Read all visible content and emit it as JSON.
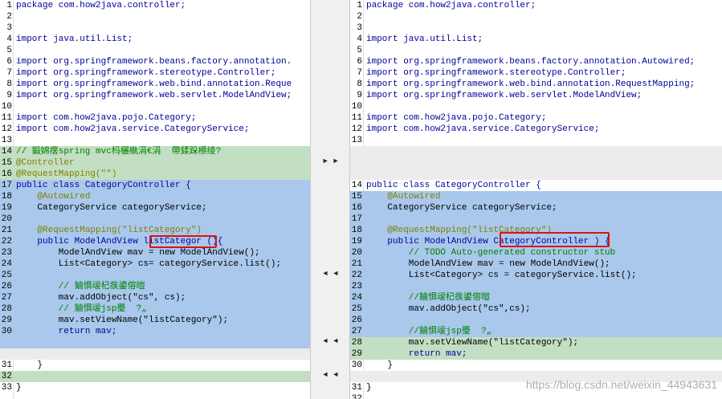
{
  "left": {
    "rows": [
      {
        "n": "1",
        "t": "package com.how2java.controller;",
        "c": ""
      },
      {
        "n": "2",
        "t": "",
        "c": ""
      },
      {
        "n": "3",
        "t": "",
        "c": ""
      },
      {
        "n": "4",
        "t": "import java.util.List;",
        "c": ""
      },
      {
        "n": "5",
        "t": "",
        "c": ""
      },
      {
        "n": "6",
        "t": "import org.springframework.beans.factory.annotation.",
        "c": ""
      },
      {
        "n": "7",
        "t": "import org.springframework.stereotype.Controller;",
        "c": ""
      },
      {
        "n": "8",
        "t": "import org.springframework.web.bind.annotation.Reque",
        "c": ""
      },
      {
        "n": "9",
        "t": "import org.springframework.web.servlet.ModelAndView;",
        "c": ""
      },
      {
        "n": "10",
        "t": "",
        "c": ""
      },
      {
        "n": "11",
        "t": "import com.how2java.pojo.Category;",
        "c": ""
      },
      {
        "n": "12",
        "t": "import com.how2java.service.CategoryService;",
        "c": ""
      },
      {
        "n": "13",
        "t": "",
        "c": ""
      },
      {
        "n": "14",
        "t": "// 鍛婂瘔spring mvc杩欐槸涓€涓  帶鍒跺櫒绫?",
        "c": "added"
      },
      {
        "n": "15",
        "t": "@Controller",
        "c": "added"
      },
      {
        "n": "16",
        "t": "@RequestMapping(\"\")",
        "c": "added"
      },
      {
        "n": "17",
        "t": "public class CategoryController {",
        "c": "changed"
      },
      {
        "n": "18",
        "t": "    @Autowired",
        "c": "changed"
      },
      {
        "n": "19",
        "t": "    CategoryService categoryService;",
        "c": "changed"
      },
      {
        "n": "20",
        "t": "",
        "c": "changed"
      },
      {
        "n": "21",
        "t": "    @RequestMapping(\"listCategory\")",
        "c": "changed"
      },
      {
        "n": "22",
        "t": "    public ModelAndView listCategor (){",
        "c": "changed"
      },
      {
        "n": "23",
        "t": "        ModelAndView mav = new ModelAndView();",
        "c": "changed"
      },
      {
        "n": "24",
        "t": "        List<Category> cs= categoryService.list();",
        "c": "changed"
      },
      {
        "n": "25",
        "t": "",
        "c": "changed"
      },
      {
        "n": "26",
        "t": "        // 鏀惧叆杞彂鍙傛暟",
        "c": "changed"
      },
      {
        "n": "27",
        "t": "        mav.addObject(\"cs\", cs);",
        "c": "changed"
      },
      {
        "n": "28",
        "t": "        // 鏀惧叆jsp璺  ?„",
        "c": "changed"
      },
      {
        "n": "29",
        "t": "        mav.setViewName(\"listCategory\");",
        "c": "changed"
      },
      {
        "n": "30",
        "t": "        return mav;",
        "c": "changed"
      },
      {
        "n": "",
        "t": "",
        "c": "changed"
      },
      {
        "n": "",
        "t": "",
        "c": "blank"
      },
      {
        "n": "31",
        "t": "    }",
        "c": ""
      },
      {
        "n": "32",
        "t": "",
        "c": "added"
      },
      {
        "n": "33",
        "t": "}",
        "c": ""
      }
    ]
  },
  "right": {
    "rows": [
      {
        "n": "1",
        "t": "package com.how2java.controller;",
        "c": ""
      },
      {
        "n": "2",
        "t": "",
        "c": ""
      },
      {
        "n": "3",
        "t": "",
        "c": ""
      },
      {
        "n": "4",
        "t": "import java.util.List;",
        "c": ""
      },
      {
        "n": "5",
        "t": "",
        "c": ""
      },
      {
        "n": "6",
        "t": "import org.springframework.beans.factory.annotation.Autowired;",
        "c": ""
      },
      {
        "n": "7",
        "t": "import org.springframework.stereotype.Controller;",
        "c": ""
      },
      {
        "n": "8",
        "t": "import org.springframework.web.bind.annotation.RequestMapping;",
        "c": ""
      },
      {
        "n": "9",
        "t": "import org.springframework.web.servlet.ModelAndView;",
        "c": ""
      },
      {
        "n": "10",
        "t": "",
        "c": ""
      },
      {
        "n": "11",
        "t": "import com.how2java.pojo.Category;",
        "c": ""
      },
      {
        "n": "12",
        "t": "import com.how2java.service.CategoryService;",
        "c": ""
      },
      {
        "n": "13",
        "t": "",
        "c": ""
      },
      {
        "n": "",
        "t": "",
        "c": "blank"
      },
      {
        "n": "",
        "t": "",
        "c": "blank"
      },
      {
        "n": "",
        "t": "",
        "c": "blank"
      },
      {
        "n": "14",
        "t": "public class CategoryController {",
        "c": ""
      },
      {
        "n": "15",
        "t": "    @Autowired",
        "c": "changed"
      },
      {
        "n": "16",
        "t": "    CategoryService categoryService;",
        "c": "changed"
      },
      {
        "n": "17",
        "t": "",
        "c": "changed"
      },
      {
        "n": "18",
        "t": "    @RequestMapping(\"listCategory\")",
        "c": "changed"
      },
      {
        "n": "19",
        "t": "    public ModelAndView CategoryController ) {",
        "c": "changed"
      },
      {
        "n": "20",
        "t": "        // TODO Auto-generated constructor stub",
        "c": "changed"
      },
      {
        "n": "21",
        "t": "        ModelAndView mav = new ModelAndView();",
        "c": "changed"
      },
      {
        "n": "22",
        "t": "        List<Category> cs = categoryService.list();",
        "c": "changed"
      },
      {
        "n": "23",
        "t": "",
        "c": "changed"
      },
      {
        "n": "24",
        "t": "        //鏀惧叆杞彂鍙傛暟",
        "c": "changed"
      },
      {
        "n": "25",
        "t": "        mav.addObject(\"cs\",cs);",
        "c": "changed"
      },
      {
        "n": "26",
        "t": "",
        "c": "changed"
      },
      {
        "n": "27",
        "t": "        //鏀惧叆jsp璺  ?„",
        "c": "changed"
      },
      {
        "n": "28",
        "t": "        mav.setViewName(\"listCategory\");",
        "c": "added"
      },
      {
        "n": "29",
        "t": "        return mav;",
        "c": "added"
      },
      {
        "n": "30",
        "t": "    }",
        "c": ""
      },
      {
        "n": "",
        "t": "",
        "c": "blank"
      },
      {
        "n": "31",
        "t": "}",
        "c": ""
      },
      {
        "n": "32",
        "t": "",
        "c": ""
      }
    ]
  },
  "merge_buttons": [
    "►  ►",
    "◄  ◄",
    "◄  ◄",
    "◄  ◄"
  ],
  "watermark": "https://blog.csdn.net/weixin_44943631"
}
